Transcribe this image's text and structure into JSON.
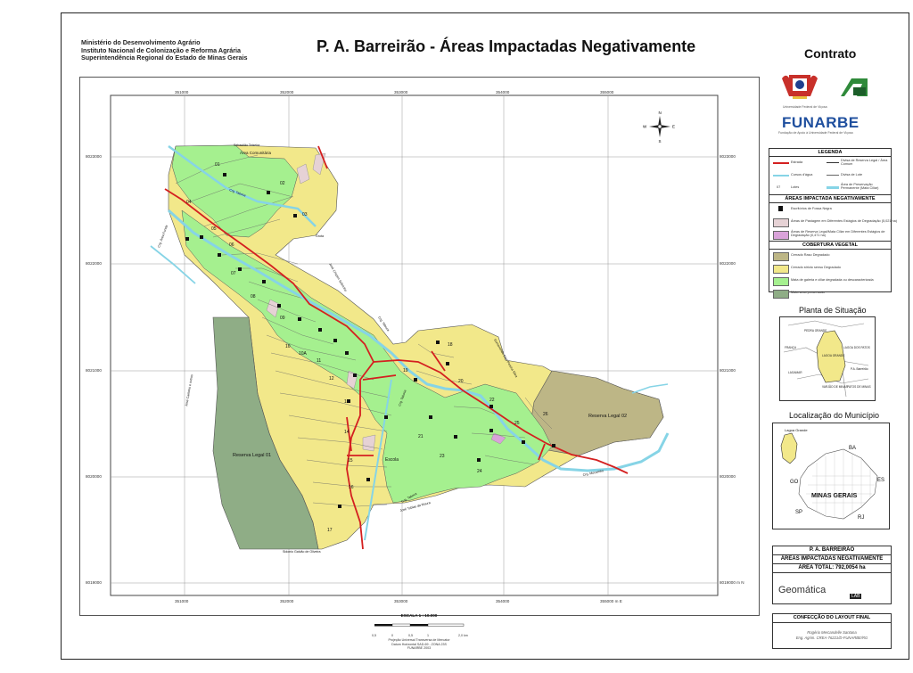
{
  "header": {
    "institution_lines": [
      "Ministério do Desenvolvimento Agrário",
      "Instituto Nacional de Colonização e Reforma Agrária",
      "Superintendência Regional do Estado de Minas Gerais"
    ],
    "title": "P. A. Barreirão - Áreas Impactadas Negativamente",
    "contrato": "Contrato",
    "logo_caption_1": "Universidade Federal de Viçosa",
    "logo_caption_2": "Fundação de Apoio à Universidade Federal de Viçosa",
    "funarbe": "FUNARBE"
  },
  "map": {
    "grid_x_labels": [
      "351000",
      "352000",
      "353000",
      "354000",
      "355000"
    ],
    "grid_x_bottom_labels": [
      "351000",
      "352000",
      "353000",
      "354000",
      "355000 m E"
    ],
    "grid_y_labels": [
      "8023000",
      "8022000",
      "8021000",
      "8020000",
      "8019000"
    ],
    "grid_y_right_labels": [
      "8023000",
      "8022000",
      "8021000",
      "8020000",
      "8019000 m N"
    ],
    "compass": {
      "n": "N",
      "s": "S",
      "e": "E",
      "w": "W"
    },
    "lot_labels": [
      "01",
      "02",
      "03",
      "04",
      "05",
      "06",
      "07",
      "08",
      "09",
      "10",
      "10A",
      "11",
      "12",
      "13",
      "14",
      "15",
      "16",
      "17",
      "18",
      "19",
      "20",
      "21",
      "22",
      "23",
      "24",
      "25",
      "26"
    ],
    "place_labels": {
      "area_comunitaria": "Área Comunitária",
      "reserva_01": "Reserva Legal 01",
      "reserva_02": "Reserva Legal 02",
      "escola": "Escola",
      "sebastiao": "Sebastião Teixeira",
      "jose_caetano": "José Caetano e outros",
      "jose_crispim": "José Crispim Sobrinho",
      "jose_tobias": "José Tobias da Moura",
      "sidonio": "Sidonio Galvão de Oliveira",
      "gumercindo": "Gumercindo Dias Pereira Silva",
      "crg_taboca_1": "Crg. Taboca",
      "crg_taboca_2": "Crg. Taboca",
      "crg_taboca_3": "Crg. Taboca",
      "crg_taboca_4": "Crg. Taboca",
      "crg_area_funda": "Crg. Área Funda",
      "crg_mocambo": "Crg. Mocambo",
      "grota": "Grota"
    },
    "colors": {
      "cerrado": "#f2e88a",
      "mata": "#a5f08f",
      "reserva_rl": "#8fad86",
      "cerrado_raso": "#bdb686",
      "pastagem": "#e6d2d5",
      "reserva_degr": "#d9a3d9",
      "estrada": "#d42020",
      "curso": "#86d4e6"
    }
  },
  "legend": {
    "title": "LEGENDA",
    "items": {
      "estrada": "Estrada",
      "divisa_reserva": "Divisa de Reserva Legal / Área Comum",
      "cursos": "Cursos d'água",
      "divisa_lote": "Divisa de Lote",
      "lote_num": "07",
      "lotes": "Lotes",
      "app": "Área de Preservação Permanente (Mata Ciliar)"
    },
    "impact_title": "ÁREAS IMPACTADA NEGATIVAMENTE",
    "impact_items": [
      "Escritórios de Fossa Negra",
      "Áreas de Pastagem em Diferentes Estágios de Degradação (5,021 ha)",
      "Áreas de Reserva Legal/Mata Ciliar em Diferentes Estágios de Degradação (0,471 ha)"
    ],
    "veg_title": "COBERTURA VEGETAL",
    "veg_items": [
      "Cerrado Raso Degradado",
      "Cerrado stricto sensu Degradado",
      "Mata de galeria e ciliar degradada ou descaracterizada",
      "Mata seca preservada"
    ]
  },
  "planta": {
    "title": "Planta de Situação",
    "labels": [
      "PEDRA GRANDE",
      "FRANÇA",
      "LAGOA GRANDE",
      "LAGOA DOS PATOS",
      "LAGAMAR",
      "PATOS DE MINAS",
      "VARJÃO DE MINAS",
      "P.A. Barreirão"
    ]
  },
  "municipio": {
    "title": "Localização do Município",
    "labels": {
      "lagoa": "Lagoa Grande",
      "ba": "BA",
      "go": "GO",
      "es": "ES",
      "mg": "MINAS GERAIS",
      "sp": "SP",
      "rj": "RJ"
    }
  },
  "info": {
    "name": "P. A. BARREIRÃO",
    "subtitle": "ÁREAS IMPACTADAS NEGATIVAMENTE",
    "area": "ÁREA TOTAL: 792,0054 ha",
    "geomatica": "Geomática",
    "lab": "LAB"
  },
  "confeccao": {
    "title": "CONFECÇÃO DO LAYOUT FINAL",
    "line1": "Rogério Mercandelle Santana",
    "line2": "Eng. Agrim. CREA-76221/D-FUNARBE/RG"
  },
  "scale": {
    "title": "ESCALA 1 : 10.000",
    "ticks": [
      "0,5",
      "0",
      "0,5",
      "1",
      "2,0 km"
    ],
    "lines": [
      "Projeção Universal Transversa de Mercator",
      "Datum Horizontal SAD-69 - ZONA 23S",
      "FUNARBE 2003"
    ]
  }
}
